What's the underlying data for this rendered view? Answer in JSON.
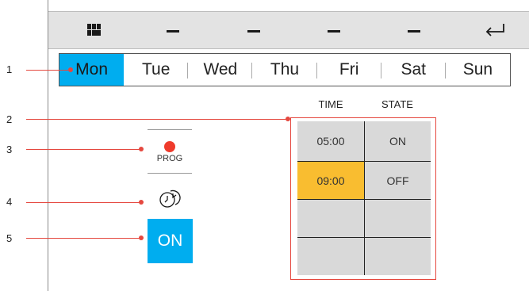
{
  "toolbar": {
    "icons": [
      "grid-icon",
      "dash-icon",
      "dash-icon",
      "dash-icon",
      "dash-icon",
      "enter-icon"
    ]
  },
  "days": [
    {
      "label": "Mon",
      "selected": true
    },
    {
      "label": "Tue",
      "selected": false
    },
    {
      "label": "Wed",
      "selected": false
    },
    {
      "label": "Thu",
      "selected": false
    },
    {
      "label": "Fri",
      "selected": false
    },
    {
      "label": "Sat",
      "selected": false
    },
    {
      "label": "Sun",
      "selected": false
    }
  ],
  "schedule": {
    "time_header": "TIME",
    "state_header": "STATE",
    "rows": [
      {
        "time": "05:00",
        "state": "ON",
        "highlighted": false
      },
      {
        "time": "09:00",
        "state": "OFF",
        "highlighted": true
      },
      {
        "time": "",
        "state": "",
        "highlighted": false
      },
      {
        "time": "",
        "state": "",
        "highlighted": false
      }
    ]
  },
  "controls": {
    "prog_label": "PROG",
    "on_label": "ON"
  },
  "callouts": [
    "1",
    "2",
    "3",
    "4",
    "5"
  ],
  "colors": {
    "accent": "#00adef",
    "highlight": "#f9bd30",
    "callout": "#e5483f",
    "cell": "#d9d9d9",
    "toolbar": "#e3e3e3"
  }
}
